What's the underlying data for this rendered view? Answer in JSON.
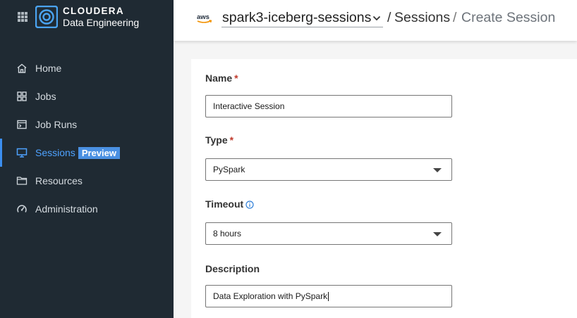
{
  "brand": {
    "name": "CLOUDERA",
    "product": "Data Engineering"
  },
  "sidebar": {
    "items": [
      {
        "label": "Home",
        "icon": "home-icon"
      },
      {
        "label": "Jobs",
        "icon": "grid-icon"
      },
      {
        "label": "Job Runs",
        "icon": "terminal-icon"
      },
      {
        "label": "Sessions",
        "icon": "monitor-icon",
        "active": true,
        "badge": "Preview"
      },
      {
        "label": "Resources",
        "icon": "folder-icon"
      },
      {
        "label": "Administration",
        "icon": "gauge-icon"
      }
    ]
  },
  "header": {
    "provider_logo": "aws",
    "cluster": "spark3-iceberg-sessions",
    "separator": "/",
    "breadcrumb_sessions": "Sessions",
    "breadcrumb_current": "Create Session"
  },
  "form": {
    "name": {
      "label": "Name",
      "required_mark": "*",
      "value": "Interactive Session"
    },
    "type": {
      "label": "Type",
      "required_mark": "*",
      "value": "PySpark"
    },
    "timeout": {
      "label": "Timeout",
      "value": "8 hours"
    },
    "description": {
      "label": "Description",
      "value": "Data Exploration with PySpark"
    }
  },
  "colors": {
    "sidebar_bg": "#1f2a33",
    "accent": "#3b8ef0",
    "badge": "#4a90e2",
    "required": "#c0392b"
  }
}
